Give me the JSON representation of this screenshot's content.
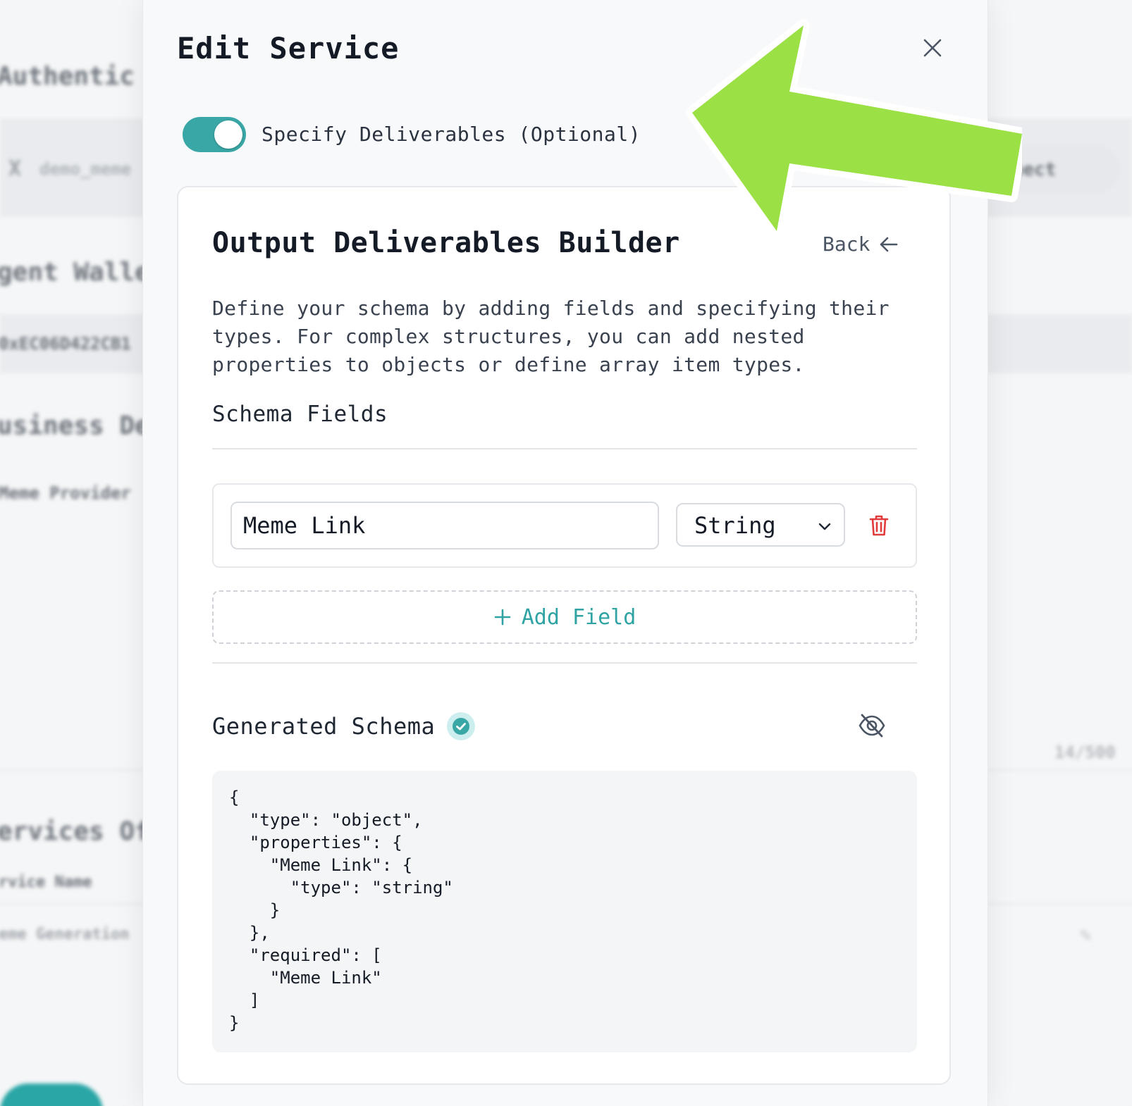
{
  "background": {
    "section_auth": "Authentic",
    "handle": "demo_meme",
    "connect_label": "nnect",
    "section_wallet": "gent Walle",
    "wallet_address": "0xEC06D422CB1",
    "section_business": "usiness De",
    "business_name": "Meme Provider",
    "char_count": "14/500",
    "section_services": "ervices Of",
    "service_name_header": "rvice Name",
    "service_row_name": "eme Generation"
  },
  "modal": {
    "title": "Edit Service",
    "toggle": {
      "label": "Specify Deliverables (Optional)",
      "on": true
    },
    "builder": {
      "title": "Output Deliverables Builder",
      "back_label": "Back",
      "description": "Define your schema by adding fields and specifying their types. For complex structures, you can add nested properties to objects or define array item types.",
      "schema_fields_label": "Schema Fields",
      "fields": [
        {
          "name": "Meme Link",
          "type": "String"
        }
      ],
      "add_field_label": "Add Field",
      "generated_schema_label": "Generated Schema",
      "schema_json": "{\n  \"type\": \"object\",\n  \"properties\": {\n    \"Meme Link\": {\n      \"type\": \"string\"\n    }\n  },\n  \"required\": [\n    \"Meme Link\"\n  ]\n}"
    }
  },
  "icons": {
    "close": "close-icon",
    "back": "arrow-left-icon",
    "dropdown": "chevron-down-icon",
    "delete": "trash-icon",
    "add": "plus-icon",
    "valid": "check-circle-icon",
    "hide": "eye-off-icon",
    "annotation": "arrow-annotation"
  },
  "colors": {
    "accent": "#3aa7a7",
    "danger": "#e23b3b",
    "annotation": "#9be145"
  }
}
